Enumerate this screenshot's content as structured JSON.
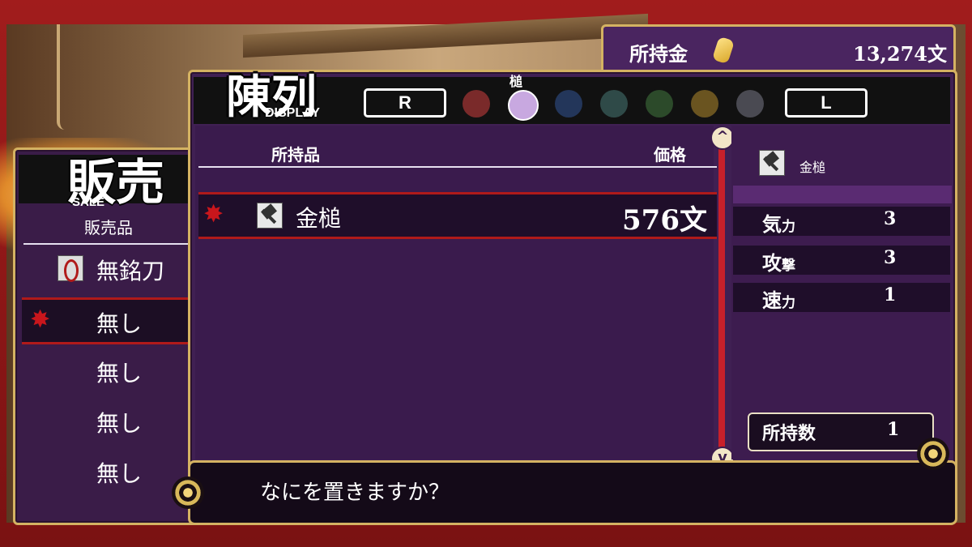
{
  "money": {
    "label": "所持金",
    "amount": "13,274文"
  },
  "sale": {
    "title": "販売",
    "subtitle": "SALE",
    "header": "販売品",
    "items": [
      {
        "label": "無銘刀",
        "icon": "sword-icon"
      },
      {
        "label": "無し",
        "selected": true
      },
      {
        "label": "無し"
      },
      {
        "label": "無し"
      },
      {
        "label": "無し"
      }
    ]
  },
  "display": {
    "title": "陳列",
    "subtitle": "DISPLAY",
    "left_key": "R",
    "right_key": "L",
    "active_category": "槌",
    "categories": [
      "fire-icon",
      "hammer-icon",
      "shield-icon",
      "leaf-icon",
      "vine-icon",
      "crescent-icon",
      "fan-icon"
    ],
    "col_item": "所持品",
    "col_price": "価格",
    "items": [
      {
        "name": "金槌",
        "price": "576文"
      }
    ]
  },
  "detail": {
    "name": "金槌",
    "stats": [
      {
        "key": "気",
        "key_small": "力",
        "value": "3"
      },
      {
        "key": "攻",
        "key_small": "撃",
        "value": "3"
      },
      {
        "key": "速",
        "key_small": "力",
        "value": "1"
      }
    ],
    "qty_label": "所持数",
    "qty_value": "1"
  },
  "message": "なにを置きますか？",
  "colors": {
    "panel": "#402053",
    "gold": "#d4b262",
    "select": "#b01a1a"
  }
}
